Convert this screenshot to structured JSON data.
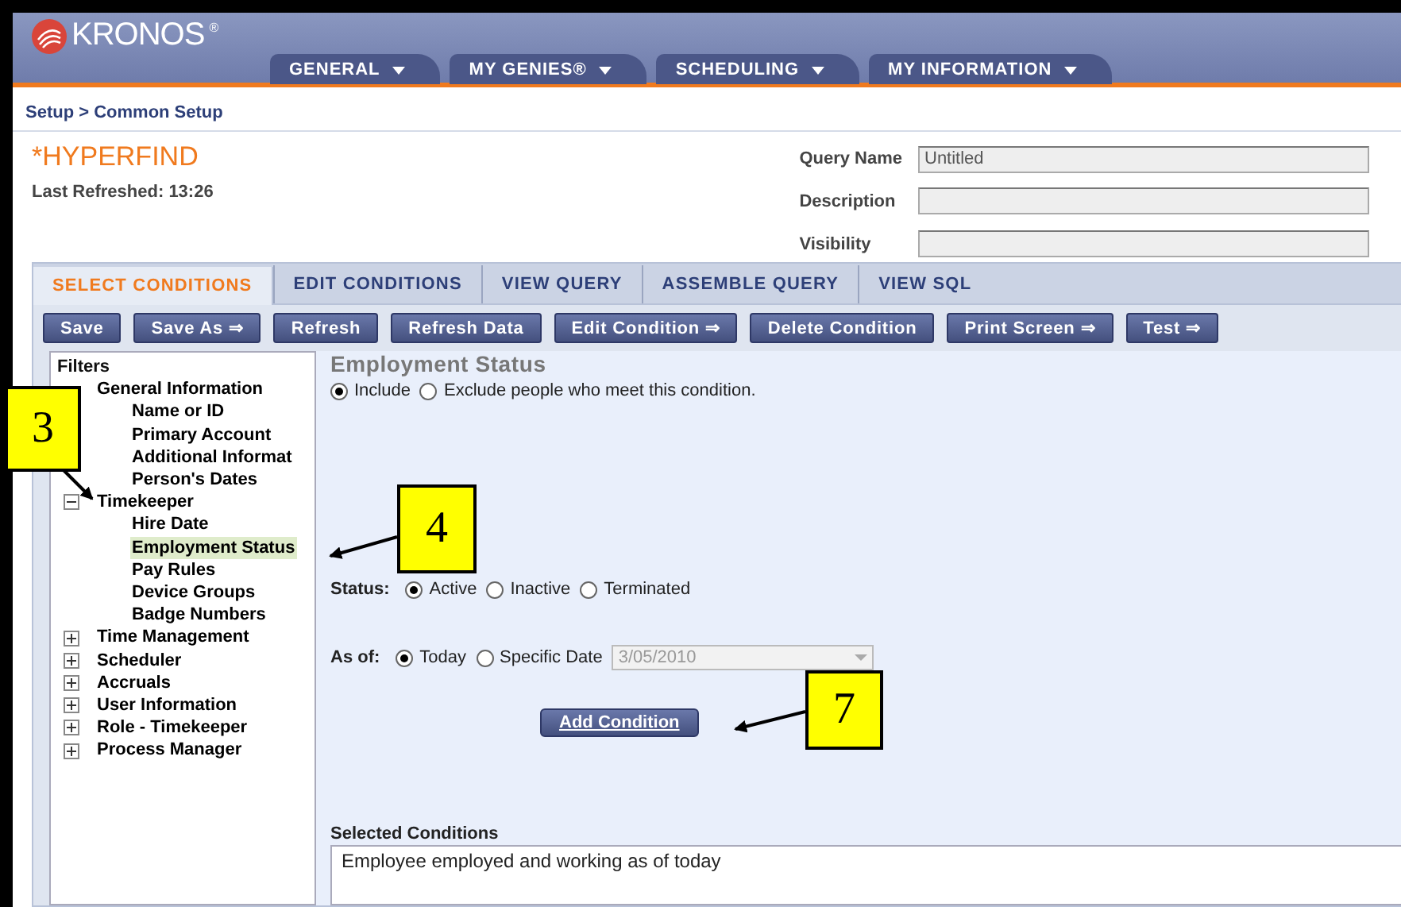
{
  "header": {
    "logo": "KRONOS",
    "logo_mark": "®",
    "tabs": [
      {
        "label": "GENERAL",
        "selected": false
      },
      {
        "label": "MY GENIES®",
        "selected": false
      },
      {
        "label": "SCHEDULING",
        "selected": false
      },
      {
        "label": "MY INFORMATION",
        "selected": false
      }
    ]
  },
  "breadcrumb": "Setup > Common Setup",
  "title": "*HYPERFIND",
  "last_refreshed": "Last Refreshed: 13:26",
  "query_fields": [
    {
      "label": "Query Name",
      "value": "Untitled"
    },
    {
      "label": "Description"
    },
    {
      "label": "Visibility"
    }
  ],
  "tabs": [
    {
      "label": "SELECT CONDITIONS",
      "selected": true
    },
    {
      "label": "EDIT CONDITIONS",
      "selected": false
    },
    {
      "label": "VIEW QUERY",
      "selected": false
    },
    {
      "label": "ASSEMBLE QUERY",
      "selected": false
    },
    {
      "label": "VIEW SQL",
      "selected": false
    }
  ],
  "toolbar": [
    "Save",
    "Save As ⇒",
    "Refresh",
    "Refresh Data",
    "Edit Condition ⇒",
    "Delete Condition",
    "Print Screen ⇒",
    "Test ⇒"
  ],
  "tree": {
    "title": "Filters",
    "items": [
      {
        "label": "General Information",
        "selected": false,
        "children": [
          {
            "label": "Name or ID",
            "selected": false
          },
          {
            "label": "Primary Account",
            "selected": false
          },
          {
            "label": "Additional Informat",
            "selected": false
          },
          {
            "label": "Person's Dates",
            "selected": false
          }
        ]
      },
      {
        "label": "Timekeeper",
        "expanded": true,
        "selected": false,
        "children": [
          {
            "label": "Hire Date",
            "selected": false
          },
          {
            "label": "Employment Status",
            "selected": true
          },
          {
            "label": "Pay Rules",
            "selected": false
          },
          {
            "label": "Device Groups",
            "selected": false
          },
          {
            "label": "Badge Numbers",
            "selected": false
          }
        ]
      },
      {
        "label": "Time Management",
        "expanded": false,
        "selected": false
      },
      {
        "label": "Scheduler",
        "expanded": false,
        "selected": false
      },
      {
        "label": "Accruals",
        "expanded": false,
        "selected": false
      },
      {
        "label": "User Information",
        "expanded": false,
        "selected": false
      },
      {
        "label": "Role - Timekeeper",
        "expanded": false,
        "selected": false
      },
      {
        "label": "Process Manager",
        "expanded": false,
        "selected": false
      }
    ]
  },
  "condition": {
    "title": "Employment Status",
    "include_options": [
      {
        "label": "Include",
        "selected": true
      },
      {
        "label": "Exclude people who meet this condition.",
        "selected": false
      }
    ],
    "status": {
      "label": "Status:",
      "options": [
        {
          "label": "Active",
          "selected": true
        },
        {
          "label": "Inactive",
          "selected": false
        },
        {
          "label": "Terminated",
          "selected": false
        }
      ]
    },
    "as_of": {
      "label": "As of:",
      "options": [
        {
          "label": "Today",
          "selected": true
        },
        {
          "label": "Specific Date",
          "selected": false
        }
      ],
      "date": "3/05/2010"
    },
    "add_button": "Add Condition"
  },
  "selected_conditions": {
    "label": "Selected Conditions",
    "value": "Employee employed and working as of today"
  },
  "callouts": [
    {
      "number": "3"
    },
    {
      "number": "4"
    },
    {
      "number": "7"
    }
  ]
}
